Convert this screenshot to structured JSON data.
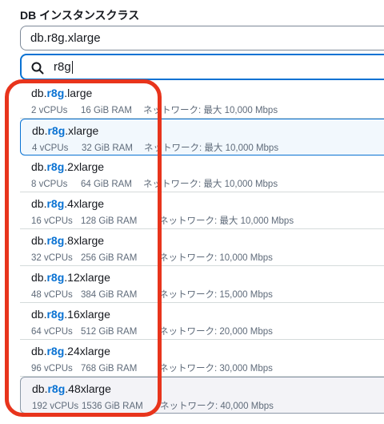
{
  "field": {
    "label": "DB インスタンスクラス",
    "selected_value": "db.r8g.xlarge",
    "search_value": "r8g"
  },
  "options": [
    {
      "prefix": "db.",
      "highlight": "r8g",
      "suffix": ".large",
      "vcpus": "2 vCPUs",
      "ram": "16 GiB RAM",
      "network": "ネットワーク: 最大 10,000 Mbps"
    },
    {
      "prefix": "db.",
      "highlight": "r8g",
      "suffix": ".xlarge",
      "vcpus": "4 vCPUs",
      "ram": "32 GiB RAM",
      "network": "ネットワーク: 最大 10,000 Mbps"
    },
    {
      "prefix": "db.",
      "highlight": "r8g",
      "suffix": ".2xlarge",
      "vcpus": "8 vCPUs",
      "ram": "64 GiB RAM",
      "network": "ネットワーク: 最大 10,000 Mbps"
    },
    {
      "prefix": "db.",
      "highlight": "r8g",
      "suffix": ".4xlarge",
      "vcpus": "16 vCPUs",
      "ram": "128 GiB RAM",
      "network": "ネットワーク: 最大 10,000 Mbps"
    },
    {
      "prefix": "db.",
      "highlight": "r8g",
      "suffix": ".8xlarge",
      "vcpus": "32 vCPUs",
      "ram": "256 GiB RAM",
      "network": "ネットワーク: 10,000 Mbps"
    },
    {
      "prefix": "db.",
      "highlight": "r8g",
      "suffix": ".12xlarge",
      "vcpus": "48 vCPUs",
      "ram": "384 GiB RAM",
      "network": "ネットワーク: 15,000 Mbps"
    },
    {
      "prefix": "db.",
      "highlight": "r8g",
      "suffix": ".16xlarge",
      "vcpus": "64 vCPUs",
      "ram": "512 GiB RAM",
      "network": "ネットワーク: 20,000 Mbps"
    },
    {
      "prefix": "db.",
      "highlight": "r8g",
      "suffix": ".24xlarge",
      "vcpus": "96 vCPUs",
      "ram": "768 GiB RAM",
      "network": "ネットワーク: 30,000 Mbps"
    },
    {
      "prefix": "db.",
      "highlight": "r8g",
      "suffix": ".48xlarge",
      "vcpus": "192 vCPUs",
      "ram": "1536 GiB RAM",
      "network": "ネットワーク: 40,000 Mbps"
    }
  ],
  "colors": {
    "accent": "#0972d3",
    "annotation_frame": "#e8341c"
  }
}
